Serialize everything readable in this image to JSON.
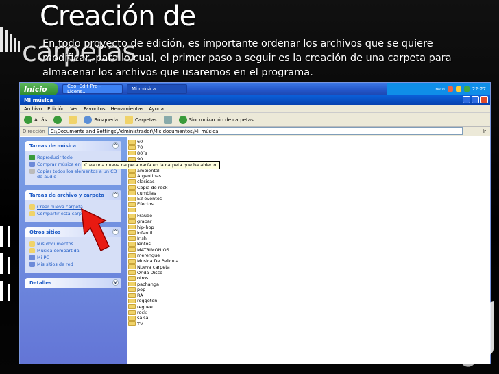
{
  "slide": {
    "title_line1": "Creación de",
    "title_line2": "carpetas",
    "body": "En todo proyecto de edición, es importante ordenar los archivos que se quiere modificar, para lo cual, el primer paso a seguir es la creación de una carpeta para almacenar los archivos que usaremos en el programa."
  },
  "taskbar": {
    "start_label": "Inicio",
    "tasks": [
      "Cool Edit Pro - Licens...",
      "Mi música"
    ],
    "clock": "22:27",
    "tray_label": "nero"
  },
  "window": {
    "title": "Mi música",
    "menu": [
      "Archivo",
      "Edición",
      "Ver",
      "Favoritos",
      "Herramientas",
      "Ayuda"
    ],
    "toolbar": {
      "back": "Atrás",
      "search": "Búsqueda",
      "folders": "Carpetas",
      "sync": "Sincronización de carpetas"
    },
    "address_label": "Dirección",
    "address_value": "C:\\Documents and Settings\\Administrador\\Mis documentos\\Mi música",
    "go_label": "Ir"
  },
  "sidepane": {
    "music_tasks": {
      "title": "Tareas de música",
      "items": [
        "Reproducir todo",
        "Comprar música en línea",
        "Copiar todos los elementos a un CD de audio"
      ]
    },
    "file_tasks": {
      "title": "Tareas de archivo y carpeta",
      "items": [
        "Crear nueva carpeta",
        "Compartir esta carpeta"
      ]
    },
    "other_places": {
      "title": "Otros sitios",
      "items": [
        "Mis documentos",
        "Música compartida",
        "Mi PC",
        "Mis sitios de red"
      ]
    },
    "details": {
      "title": "Detalles"
    }
  },
  "tooltip": "Crea una nueva carpeta vacía en la carpeta que ha abierto.",
  "folders": [
    "60",
    "70",
    "80´s",
    "90",
    "albunes",
    "ambiental",
    "Argentinas",
    "clasicas",
    "Copia de rock",
    "cumbias",
    "E2 eventos",
    "Efectos",
    "",
    "Fraude",
    "grabar",
    "hip-hop",
    "infantil",
    "Irish",
    "lentos",
    "MATRIMONIOS",
    "merengue",
    "Musica De Pelicula",
    "Nueva carpeta",
    "Onda Disco",
    "otros",
    "pachanga",
    "pop",
    "RA",
    "reggeton",
    "reguee",
    "rock",
    "salsa",
    "TV"
  ],
  "colors": {
    "xp_blue": "#2456c8",
    "arrow_red": "#e81a12",
    "folder_yellow": "#f0d36a"
  }
}
